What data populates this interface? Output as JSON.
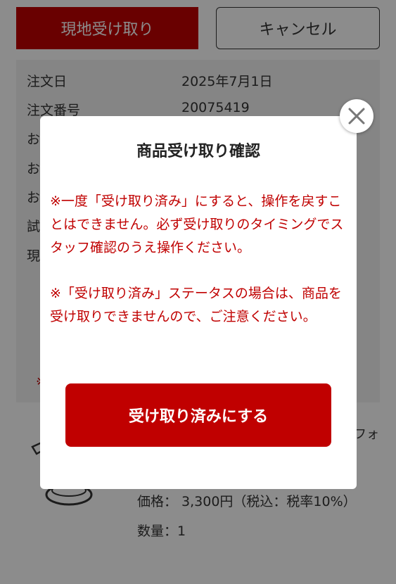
{
  "actions": {
    "pickup_label": "現地受け取り",
    "cancel_label": "キャンセル"
  },
  "order": {
    "date_label": "注文日",
    "date_value": "2025年7月1日",
    "number_label": "注文番号",
    "number_value": "20075419",
    "row3_label": "お",
    "row4_label": "お",
    "row5_label": "お",
    "row6_label": "試",
    "row7_label": "現",
    "note_mark": "※"
  },
  "product": {
    "name_tail": "フォ",
    "price": "価格： 3,300円（税込：税率10%）",
    "quantity": "数量：1"
  },
  "modal": {
    "title": "商品受け取り確認",
    "text1": "※一度「受け取り済み」にすると、操作を戻すことはできません。必ず受け取りのタイミングでスタッフ確認のうえ操作ください。",
    "text2": "※「受け取り済み」ステータスの場合は、商品を受け取りできませんので、ご注意ください。",
    "confirm_label": "受け取り済みにする"
  },
  "colors": {
    "brand_red": "#c00000",
    "overlay": "rgba(0,0,0,0.45)"
  }
}
